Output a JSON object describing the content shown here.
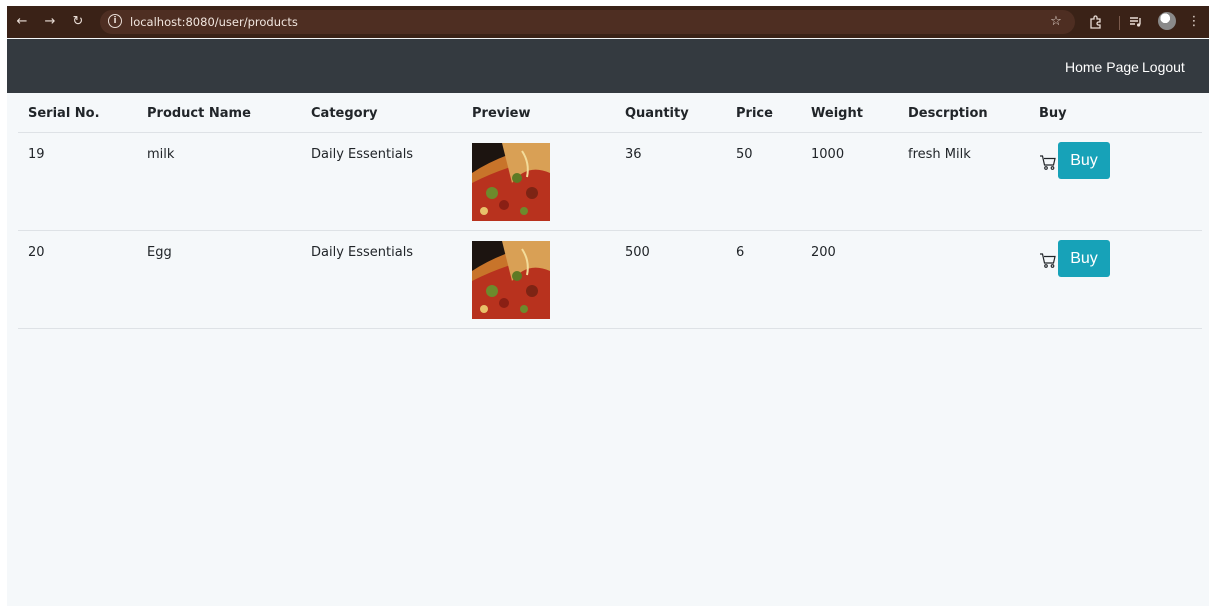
{
  "browser": {
    "url": "localhost:8080/user/products"
  },
  "navbar": {
    "home_label": "Home Page",
    "logout_label": "Logout"
  },
  "table": {
    "headers": [
      "Serial No.",
      "Product Name",
      "Category",
      "Preview",
      "Quantity",
      "Price",
      "Weight",
      "Descrption",
      "Buy"
    ],
    "rows": [
      {
        "serial": "19",
        "name": "milk",
        "category": "Daily Essentials",
        "preview": "pizza-image",
        "quantity": "36",
        "price": "50",
        "weight": "1000",
        "description": "fresh Milk",
        "buy_label": "Buy"
      },
      {
        "serial": "20",
        "name": "Egg",
        "category": "Daily Essentials",
        "preview": "pizza-image",
        "quantity": "500",
        "price": "6",
        "weight": "200",
        "description": "",
        "buy_label": "Buy"
      }
    ]
  },
  "colors": {
    "browser_bar": "#3a2217",
    "navbar": "#343a40",
    "buy_button": "#17a2b8",
    "page_bg": "#f5f8fa"
  },
  "icons": {
    "cart": "cart-icon",
    "back": "back-arrow-icon",
    "forward": "forward-arrow-icon",
    "reload": "reload-icon",
    "info": "info-icon",
    "star": "star-icon",
    "extensions": "puzzle-icon",
    "media": "media-control-icon",
    "menu": "more-vert-icon"
  }
}
